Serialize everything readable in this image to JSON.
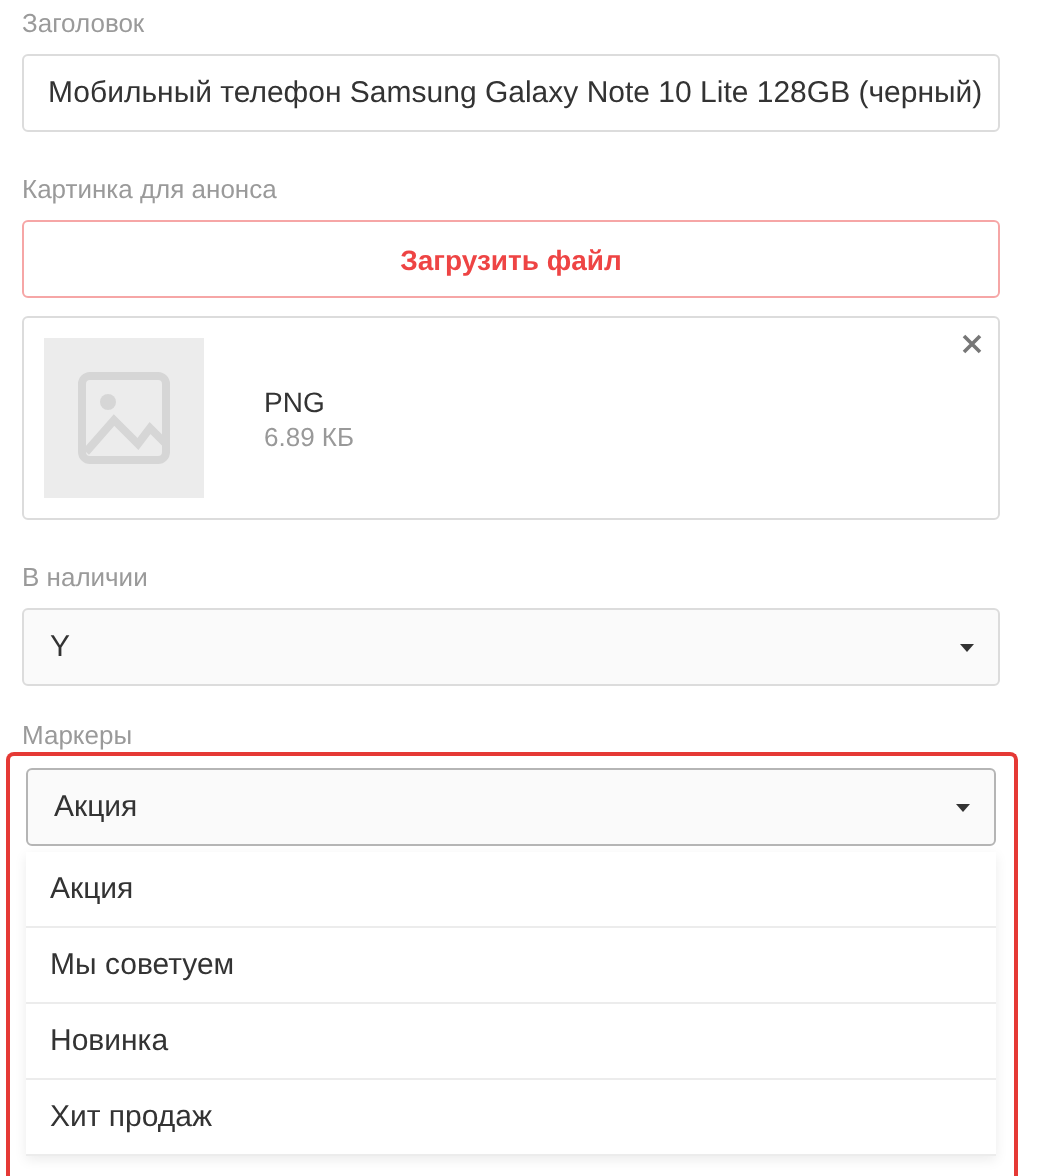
{
  "title_field": {
    "label": "Заголовок",
    "value": "Мобильный телефон Samsung Galaxy Note 10 Lite 128GB (черный)"
  },
  "image_field": {
    "label": "Картинка для анонса",
    "upload_button": "Загрузить файл",
    "file": {
      "type": "PNG",
      "size": "6.89 КБ",
      "kind": "picture"
    }
  },
  "stock_field": {
    "label": "В наличии",
    "value": "Y",
    "expanded": false
  },
  "markers_field": {
    "label": "Маркеры",
    "value": "Акция",
    "expanded": true,
    "highlighted": true,
    "options": [
      "Акция",
      "Мы советуем",
      "Новинка",
      "Хит продаж"
    ]
  }
}
